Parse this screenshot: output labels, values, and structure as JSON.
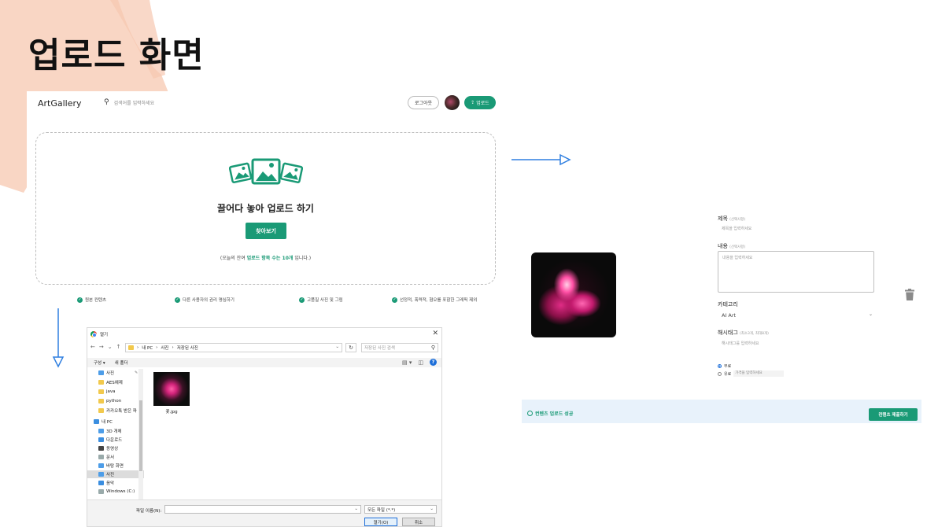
{
  "slide": {
    "title": "업로드 화면"
  },
  "header": {
    "brand": "ArtGallery",
    "search_placeholder": "검색어를 입력하세요",
    "logout_label": "로그아웃",
    "upload_label": "업로드"
  },
  "dropzone": {
    "title": "끌어다 놓아 업로드 하기",
    "browse_label": "찾아보기",
    "note_prefix": "(오늘의 잔여 ",
    "note_highlight": "업로드 항목 수는 10개",
    "note_suffix": " 입니다.)"
  },
  "features": [
    {
      "label": "원본 컨텐츠"
    },
    {
      "label": "다른 사용자의 권리 명심하기"
    },
    {
      "label": "고품질 사진 및 그림"
    },
    {
      "label": "선정적, 폭력적, 혐오를 포함한 그레픽 제외"
    }
  ],
  "dialog": {
    "title": "열기",
    "path": [
      "내 PC",
      "사진",
      "저장된 사진"
    ],
    "search_placeholder": "저장된 사진 검색",
    "organize": "구성 ▾",
    "new_folder": "새 폴더",
    "tree": [
      {
        "label": "사진",
        "icon": "folder-icon",
        "selected": false
      },
      {
        "label": "AES예제",
        "icon": "folder-icon",
        "selected": false
      },
      {
        "label": "java",
        "icon": "folder-icon",
        "selected": false
      },
      {
        "label": "python",
        "icon": "folder-icon",
        "selected": false
      },
      {
        "label": "카카오톡 받은 파",
        "icon": "folder-icon",
        "selected": false
      },
      {
        "label": "내 PC",
        "icon": "pc-icon",
        "selected": false
      },
      {
        "label": "3D 개체",
        "icon": "cube-icon",
        "selected": false
      },
      {
        "label": "다운로드",
        "icon": "download-icon",
        "selected": false
      },
      {
        "label": "동영상",
        "icon": "video-icon",
        "selected": false
      },
      {
        "label": "문서",
        "icon": "document-icon",
        "selected": false
      },
      {
        "label": "바탕 화면",
        "icon": "desktop-icon",
        "selected": false
      },
      {
        "label": "사진",
        "icon": "picture-icon",
        "selected": true
      },
      {
        "label": "음악",
        "icon": "music-icon",
        "selected": false
      },
      {
        "label": "Windows (C:)",
        "icon": "drive-icon",
        "selected": false
      }
    ],
    "file": {
      "name": "꽃.jpg"
    },
    "filename_label": "파일 이름(N):",
    "filename_value": "",
    "filetype_value": "모든 파일 (*.*)",
    "open_label": "열기(O)",
    "cancel_label": "취소"
  },
  "form": {
    "title_label": "제목",
    "title_opt": "(선택사항)",
    "title_placeholder": "제목을 입력하세요",
    "content_label": "내용",
    "content_opt": "(선택사항)",
    "content_placeholder": "내용을 입력하세요",
    "category_label": "카테고리",
    "category_value": "AI Art",
    "hashtag_label": "해시태그",
    "hashtag_opt": "(최소3개, 최대8개)",
    "hashtag_placeholder": "해시태그를 입력하세요",
    "radio_free": "무료",
    "radio_paid": "유료",
    "price_placeholder": "가격을 입력하세요"
  },
  "status_bar": {
    "message": "컨텐츠 업로드 성공",
    "submit_label": "컨텐츠 제출하기"
  },
  "colors": {
    "accent": "#1a9a76",
    "deco": "#f9d6c4",
    "arrow": "#2f7fe0",
    "bar": "#e8f2fb"
  }
}
